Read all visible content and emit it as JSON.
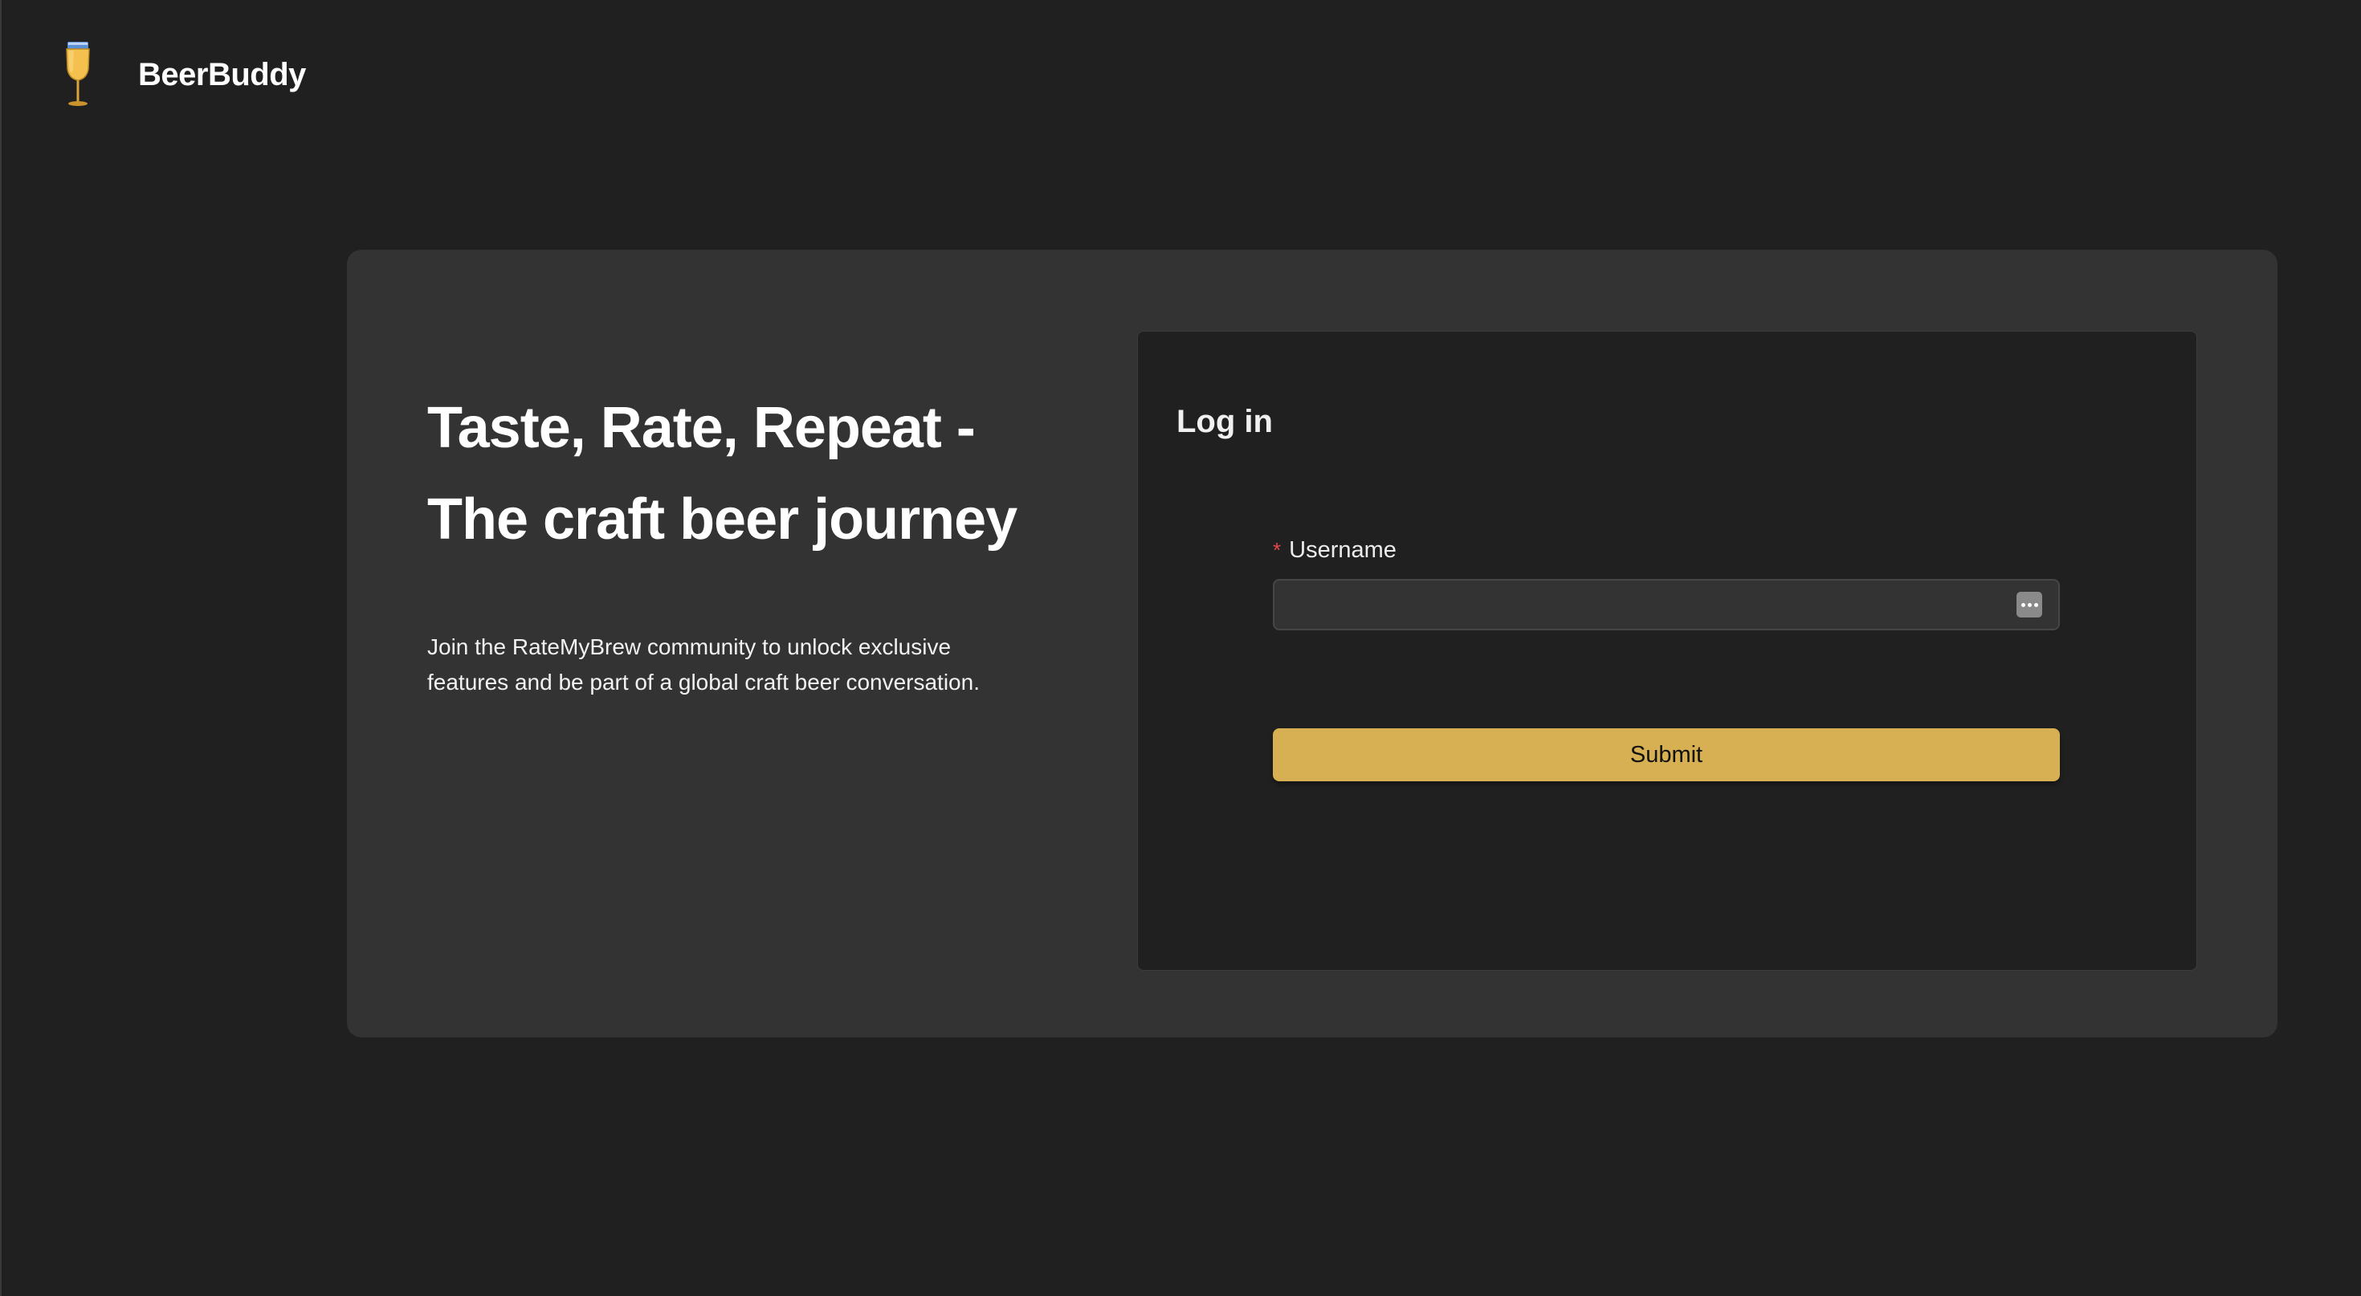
{
  "app": {
    "name": "BeerBuddy",
    "logo_icon": "beer-glass-icon"
  },
  "hero": {
    "heading_line1": "Taste, Rate, Repeat -",
    "heading_line2": "The craft beer journey",
    "description": "Join the RateMyBrew community to unlock exclusive features and be part of a global craft beer conversation."
  },
  "login": {
    "title": "Log in",
    "username_label": "Username",
    "required_marker": "*",
    "username_value": "",
    "submit_label": "Submit",
    "autofill_icon": "more-dots-icon"
  },
  "colors": {
    "background": "#202020",
    "card": "#333333",
    "accent": "#d6b052",
    "required": "#e4484d"
  }
}
